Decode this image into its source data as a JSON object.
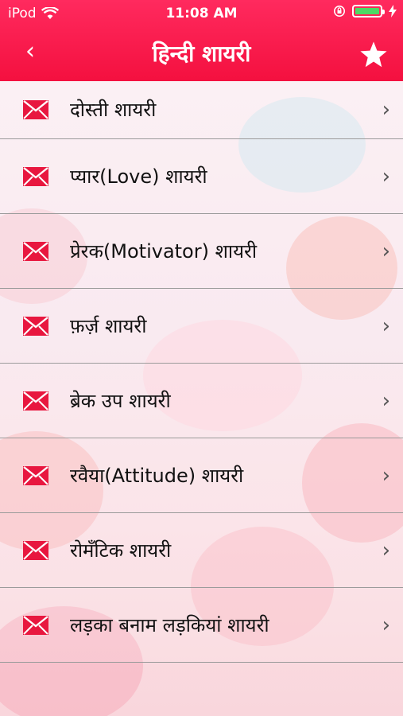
{
  "status_bar": {
    "carrier": "iPod",
    "time": "11:08 AM"
  },
  "nav": {
    "title": "हिन्दी शायरी",
    "back_glyph": "‹"
  },
  "icons": {
    "back": "chevron-left-icon",
    "favorite": "star-icon",
    "item": "envelope-icon",
    "disclosure": "chevron-right-icon"
  },
  "colors": {
    "nav_bar": "#f4103f",
    "envelope": "#e8173f",
    "battery": "#4cd964"
  },
  "list": {
    "chevron": "›",
    "items": [
      {
        "label": "दोस्ती शायरी"
      },
      {
        "label": "प्यार(Love) शायरी"
      },
      {
        "label": "प्रेरक(Motivator) शायरी"
      },
      {
        "label": "फ़र्ज़ शायरी"
      },
      {
        "label": "ब्रेक उप शायरी"
      },
      {
        "label": "रवैया(Attitude) शायरी"
      },
      {
        "label": "रोमँटिक शायरी"
      },
      {
        "label": "लड़का बनाम लड़कियां शायरी"
      }
    ]
  }
}
